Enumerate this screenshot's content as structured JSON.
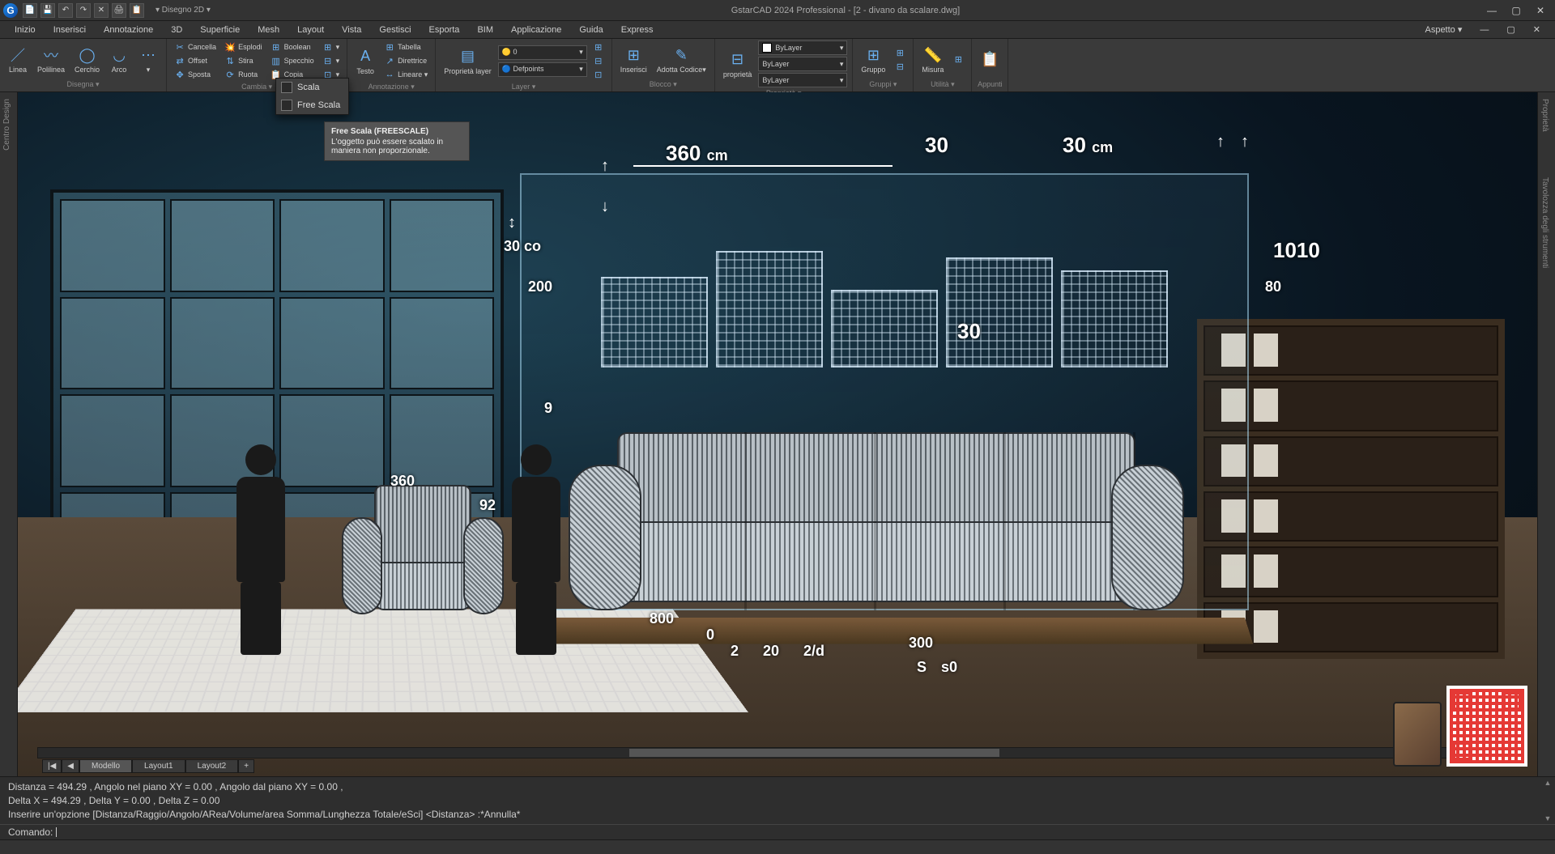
{
  "app": {
    "title": "GstarCAD 2024 Professional - [2 - divano da scalare.dwg]",
    "logo_letter": "G",
    "aspect_label": "Aspetto ▾"
  },
  "qat": [
    "📄",
    "💾",
    "↶",
    "↷",
    "✕",
    "🖨",
    "📋"
  ],
  "menu": [
    "Inizio",
    "Inserisci",
    "Annotazione",
    "3D",
    "Superficie",
    "Mesh",
    "Layout",
    "Vista",
    "Gestisci",
    "Esporta",
    "BIM",
    "Applicazione",
    "Guida",
    "Express"
  ],
  "window_controls": {
    "min": "—",
    "max": "▢",
    "close": "✕"
  },
  "ribbon": {
    "disegna": {
      "label": "Disegna ▾",
      "btns": [
        {
          "icon": "／",
          "lbl": "Linea"
        },
        {
          "icon": "〰",
          "lbl": "Polilinea"
        },
        {
          "icon": "◯",
          "lbl": "Cerchio"
        },
        {
          "icon": "◡",
          "lbl": "Arco"
        },
        {
          "icon": "⋯",
          "lbl": "▾"
        }
      ]
    },
    "cambia": {
      "label": "Cambia ▾",
      "rows": [
        [
          {
            "i": "✂",
            "t": "Cancella"
          },
          {
            "i": "💥",
            "t": "Esplodi"
          },
          {
            "i": "⊞",
            "t": "Boolean"
          }
        ],
        [
          {
            "i": "⇄",
            "t": "Offset"
          },
          {
            "i": "⇅",
            "t": "Stira"
          },
          {
            "i": "▥",
            "t": "Specchio"
          }
        ],
        [
          {
            "i": "✥",
            "t": "Sposta"
          },
          {
            "i": "⟳",
            "t": "Ruota"
          },
          {
            "i": "📋",
            "t": "Copia"
          }
        ]
      ]
    },
    "annotazione": {
      "label": "Annotazione ▾",
      "big": {
        "icon": "A",
        "lbl": "Testo"
      },
      "rows": [
        {
          "i": "⊞",
          "t": "Tabella"
        },
        {
          "i": "↗",
          "t": "Direttrice"
        },
        {
          "i": "↔",
          "t": "Lineare ▾"
        }
      ]
    },
    "layer": {
      "label": "Layer ▾",
      "big": {
        "icon": "▤",
        "lbl": "Proprietà layer"
      },
      "combos": [
        "🟡 0",
        "🔵 Defpoints"
      ]
    },
    "blocco": {
      "label": "Blocco ▾",
      "btns": [
        {
          "icon": "⊞",
          "lbl": "Inserisci"
        },
        {
          "icon": "✎",
          "lbl": "Adotta Codice▾"
        }
      ]
    },
    "proprieta": {
      "label": "Proprietà ▾",
      "big": {
        "icon": "⊟",
        "lbl": "proprietà"
      },
      "combos": [
        {
          "swatch": "#ffffff",
          "text": "ByLayer"
        },
        {
          "line": "—————",
          "text": "ByLayer"
        },
        {
          "line": "━━━━━",
          "text": "ByLayer"
        }
      ]
    },
    "gruppi": {
      "label": "Gruppi ▾",
      "btns": [
        {
          "icon": "⊞",
          "lbl": "Gruppo"
        }
      ]
    },
    "utilita": {
      "label": "Utilità ▾",
      "btns": [
        {
          "icon": "📏",
          "lbl": "Misura"
        }
      ]
    },
    "appunti": {
      "label": "Appunti",
      "btns": [
        {
          "icon": "📋",
          "lbl": "."
        }
      ]
    }
  },
  "dropdown": {
    "items": [
      {
        "label": "Scala"
      },
      {
        "label": "Free Scala"
      }
    ]
  },
  "tooltip": {
    "title": "Free Scala (FREESCALE)",
    "body": "L'oggetto può essere scalato in maniera non proporzionale."
  },
  "model_tabs": {
    "nav_l": "◀",
    "nav_ll": "|◀",
    "tabs": [
      "Modello",
      "Layout1",
      "Layout2"
    ],
    "add": "+"
  },
  "left_tab": "Centro Design",
  "right_tab": "Proprietà",
  "right_tab2": "Tavolozza degli strumenti",
  "dimensions": {
    "d360": "360",
    "unit_cm": "cm",
    "d30a": "30",
    "d30b": "30",
    "d30co": "30 co",
    "d200": "200",
    "d1010": "1010",
    "d80": "80",
    "d30mid": "30",
    "dQ": "9",
    "d92": "92",
    "d360s": "360",
    "d800": "800",
    "d0": "0",
    "d2": "2",
    "d20": "20",
    "d2d": "2/d",
    "d300": "300",
    "dS": "S",
    "ds0": "s0"
  },
  "command": {
    "hist": [
      "Distanza = 494.29 , Angolo nel piano XY = 0.00 , Angolo dal piano XY = 0.00 ,",
      "Delta X = 494.29 , Delta Y = 0.00 , Delta Z = 0.00",
      "Inserire un'opzione [Distanza/Raggio/Angolo/ARea/Volume/area Somma/Lunghezza Totale/eSci] <Distanza> :*Annulla*"
    ],
    "prompt": "Comando:"
  }
}
